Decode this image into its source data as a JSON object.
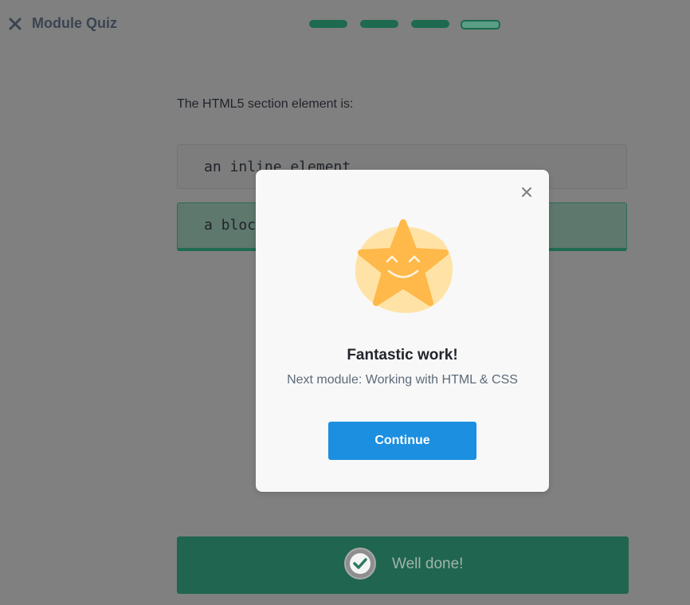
{
  "header": {
    "title": "Module Quiz",
    "close_icon": "close-icon",
    "progress": {
      "total": 4,
      "current": 4
    }
  },
  "question": {
    "text": "The HTML5 section element is:",
    "options": [
      {
        "label": "an inline element"
      },
      {
        "label": "a block element",
        "selected": true
      }
    ]
  },
  "result_bar": {
    "label": "Well done!",
    "icon": "check-icon"
  },
  "modal": {
    "close_icon": "close-icon",
    "illustration": "smiling-star-icon",
    "title": "Fantastic work!",
    "subtitle": "Next module: Working with HTML & CSS",
    "continue_label": "Continue"
  },
  "colors": {
    "accent_green": "#1d6a4f",
    "button_blue": "#1c8fe0",
    "star_yellow": "#ffb84a"
  }
}
